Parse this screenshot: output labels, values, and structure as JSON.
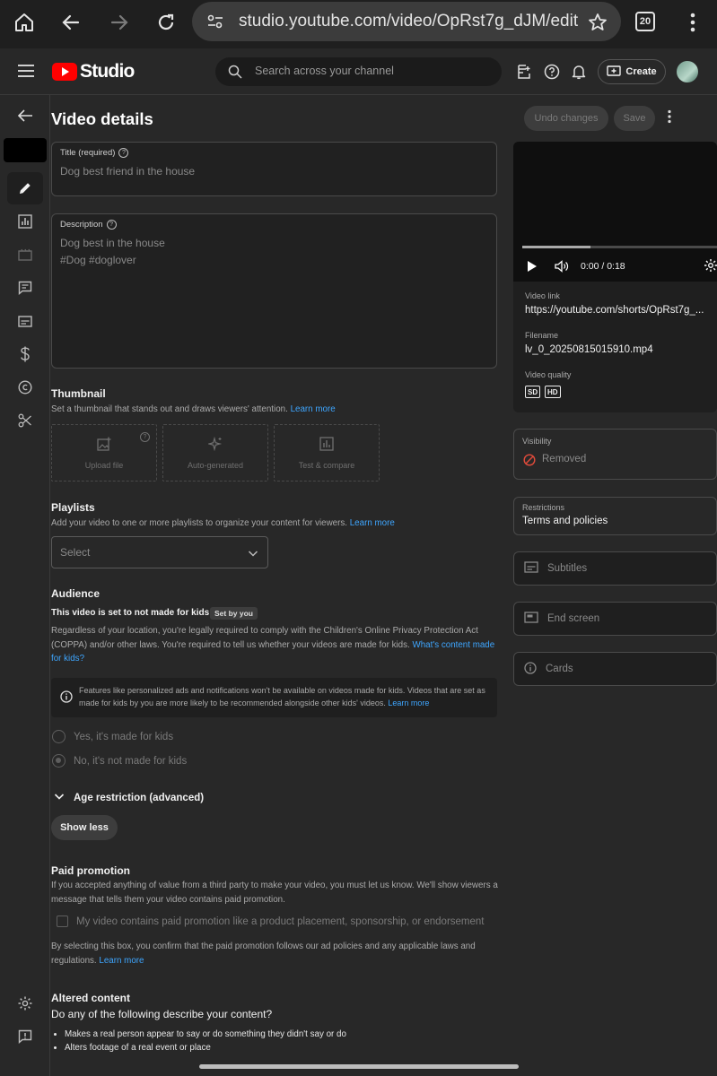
{
  "browser": {
    "url": "studio.youtube.com/video/OpRst7g_dJM/edit",
    "tab_count": "20"
  },
  "header": {
    "logo_text": "Studio",
    "search_placeholder": "Search across your channel",
    "create_label": "Create"
  },
  "page": {
    "title": "Video details",
    "undo_label": "Undo changes",
    "save_label": "Save"
  },
  "title_field": {
    "label": "Title (required)",
    "value": "Dog best friend in the house"
  },
  "description_field": {
    "label": "Description",
    "line1": "Dog best in the house",
    "line2": "#Dog #doglover"
  },
  "thumbnail": {
    "title": "Thumbnail",
    "desc": "Set a thumbnail that stands out and draws viewers' attention.",
    "learn_more": "Learn more",
    "options": [
      "Upload file",
      "Auto-generated",
      "Test & compare"
    ]
  },
  "playlists": {
    "title": "Playlists",
    "desc": "Add your video to one or more playlists to organize your content for viewers.",
    "learn_more": "Learn more",
    "select_value": "Select"
  },
  "audience": {
    "title": "Audience",
    "status": "This video is set to not made for kids",
    "badge": "Set by you",
    "desc": "Regardless of your location, you're legally required to comply with the Children's Online Privacy Protection Act (COPPA) and/or other laws. You're required to tell us whether your videos are made for kids.",
    "link": "What's content made for kids?",
    "info": "Features like personalized ads and notifications won't be available on videos made for kids. Videos that are set as made for kids by you are more likely to be recommended alongside other kids' videos.",
    "info_link": "Learn more",
    "option_yes": "Yes, it's made for kids",
    "option_no": "No, it's not made for kids",
    "age_restriction": "Age restriction (advanced)",
    "show_less": "Show less"
  },
  "paid_promotion": {
    "title": "Paid promotion",
    "desc": "If you accepted anything of value from a third party to make your video, you must let us know. We'll show viewers a message that tells them your video contains paid promotion.",
    "checkbox_label": "My video contains paid promotion like a product placement, sponsorship, or endorsement",
    "note": "By selecting this box, you confirm that the paid promotion follows our ad policies and any applicable laws and regulations.",
    "learn_more": "Learn more"
  },
  "altered_content": {
    "title": "Altered content",
    "question": "Do any of the following describe your content?",
    "items": [
      "Makes a real person appear to say or do something they didn't say or do",
      "Alters footage of a real event or place"
    ]
  },
  "preview": {
    "time": "0:00 / 0:18",
    "progress": 0.35,
    "video_link_label": "Video link",
    "video_link": "https://youtube.com/shorts/OpRst7g_...",
    "filename_label": "Filename",
    "filename": "lv_0_20250815015910.mp4",
    "quality_label": "Video quality",
    "quality_badges": [
      "SD",
      "HD"
    ]
  },
  "visibility": {
    "label": "Visibility",
    "value": "Removed"
  },
  "restrictions": {
    "label": "Restrictions",
    "value": "Terms and policies"
  },
  "side_buttons": {
    "subtitles": "Subtitles",
    "end_screen": "End screen",
    "cards": "Cards"
  },
  "colors": {
    "background": "#282828",
    "link": "#3ea6ff",
    "brand_red": "#ff0000",
    "removed_red": "#e24b3b"
  }
}
